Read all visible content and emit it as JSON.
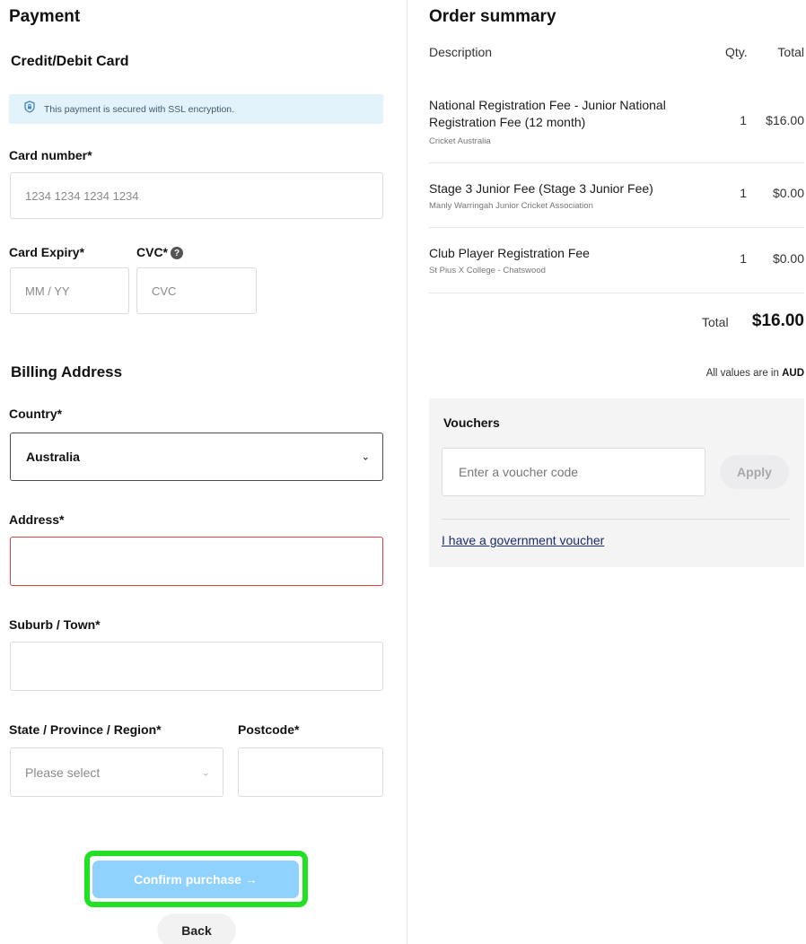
{
  "payment": {
    "title": "Payment",
    "method_title": "Credit/Debit Card",
    "ssl_notice": "This payment is secured with SSL encryption.",
    "card_number_label": "Card number*",
    "card_number_placeholder": "1234 1234 1234 1234",
    "expiry_label": "Card Expiry*",
    "expiry_placeholder": "MM / YY",
    "cvc_label": "CVC*",
    "cvc_placeholder": "CVC"
  },
  "billing": {
    "title": "Billing Address",
    "country_label": "Country*",
    "country_value": "Australia",
    "address_label": "Address*",
    "address_value": "",
    "suburb_label": "Suburb / Town*",
    "suburb_value": "",
    "state_label": "State / Province / Region*",
    "state_placeholder": "Please select",
    "postcode_label": "Postcode*",
    "postcode_value": ""
  },
  "actions": {
    "confirm_label": "Confirm purchase →",
    "back_label": "Back"
  },
  "order": {
    "title": "Order summary",
    "col_description": "Description",
    "col_qty": "Qty.",
    "col_total": "Total",
    "items": [
      {
        "title": "National Registration Fee - Junior National Registration Fee (12 month)",
        "subtitle": "Cricket Australia",
        "qty": "1",
        "total": "$16.00"
      },
      {
        "title": "Stage 3 Junior Fee (Stage 3 Junior Fee)",
        "subtitle": "Manly Warringah Junior Cricket Association",
        "qty": "1",
        "total": "$0.00"
      },
      {
        "title": "Club Player Registration Fee",
        "subtitle": "St Pius X College - Chatswood",
        "qty": "1",
        "total": "$0.00"
      }
    ],
    "total_label": "Total",
    "total_value": "$16.00",
    "currency_note": "All values are in",
    "currency": "AUD"
  },
  "vouchers": {
    "title": "Vouchers",
    "input_placeholder": "Enter a voucher code",
    "apply_label": "Apply",
    "gov_link": "I have a government voucher"
  },
  "colors": {
    "primary_button": "#8fd1ff",
    "highlight_outline": "#22e023",
    "error_border": "#d84444",
    "ssl_banner_bg": "#e3f3fb",
    "link": "#1a2c6b"
  }
}
